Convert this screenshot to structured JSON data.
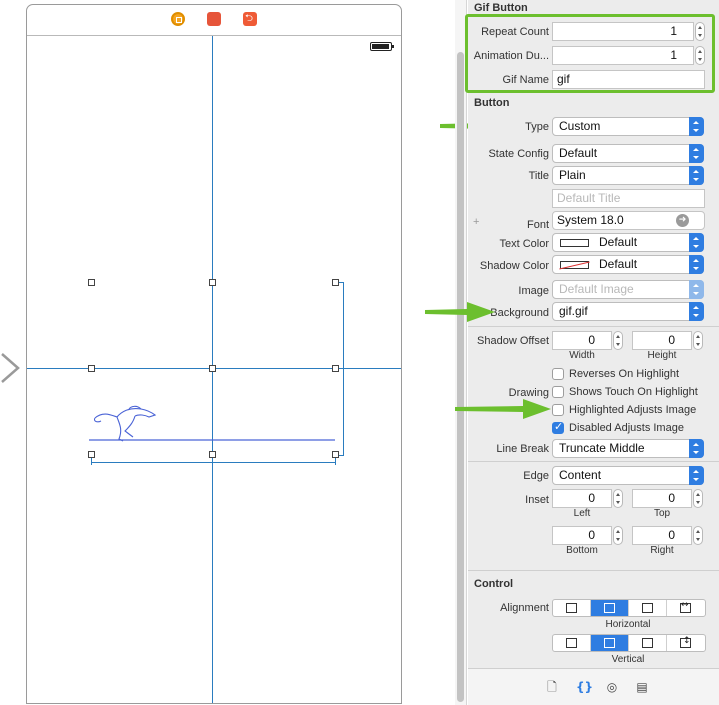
{
  "colors": {
    "accent": "#2f7de1",
    "highlight": "#6cbf2e",
    "guide": "#2a7cbf"
  },
  "canvas": {
    "dock_icons": [
      "view-controller-icon",
      "first-responder-icon",
      "exit-icon"
    ],
    "status_icons": [
      "battery-icon"
    ],
    "image_element": "running-figure-gif"
  },
  "inspector": {
    "gif_button": {
      "title": "Gif Button",
      "repeat_count": {
        "label": "Repeat Count",
        "value": "1"
      },
      "animation_duration": {
        "label": "Animation Du...",
        "value": "1"
      },
      "gif_name": {
        "label": "Gif Name",
        "value": "gif"
      }
    },
    "button": {
      "title": "Button",
      "type": {
        "label": "Type",
        "value": "Custom"
      },
      "state_config": {
        "label": "State Config",
        "value": "Default"
      },
      "title_row": {
        "label": "Title",
        "value": "Plain",
        "placeholder": "Default Title"
      },
      "font": {
        "label": "Font",
        "value": "System 18.0"
      },
      "text_color": {
        "label": "Text Color",
        "value": "Default"
      },
      "shadow_color": {
        "label": "Shadow Color",
        "value": "Default"
      },
      "image": {
        "label": "Image",
        "placeholder": "Default Image"
      },
      "background": {
        "label": "Background",
        "value": "gif.gif"
      },
      "shadow_offset": {
        "label": "Shadow Offset",
        "width": "0",
        "height": "0",
        "width_label": "Width",
        "height_label": "Height"
      },
      "reverses": {
        "label": "Reverses On Highlight",
        "checked": false
      },
      "drawing_label": "Drawing",
      "shows_touch": {
        "label": "Shows Touch On Highlight",
        "checked": false
      },
      "highlighted_adjusts": {
        "label": "Highlighted Adjusts Image",
        "checked": false
      },
      "disabled_adjusts": {
        "label": "Disabled Adjusts Image",
        "checked": true
      },
      "line_break": {
        "label": "Line Break",
        "value": "Truncate Middle"
      },
      "edge": {
        "label": "Edge",
        "value": "Content"
      },
      "inset": {
        "label": "Inset",
        "left": "0",
        "top": "0",
        "bottom": "0",
        "right": "0",
        "left_label": "Left",
        "top_label": "Top",
        "bottom_label": "Bottom",
        "right_label": "Right"
      }
    },
    "control": {
      "title": "Control",
      "alignment_label": "Alignment",
      "horizontal_label": "Horizontal",
      "vertical_label": "Vertical"
    },
    "bottom_tabs": [
      "file-inspector-icon",
      "quick-help-icon",
      "identity-inspector-icon",
      "attributes-inspector-icon"
    ]
  }
}
